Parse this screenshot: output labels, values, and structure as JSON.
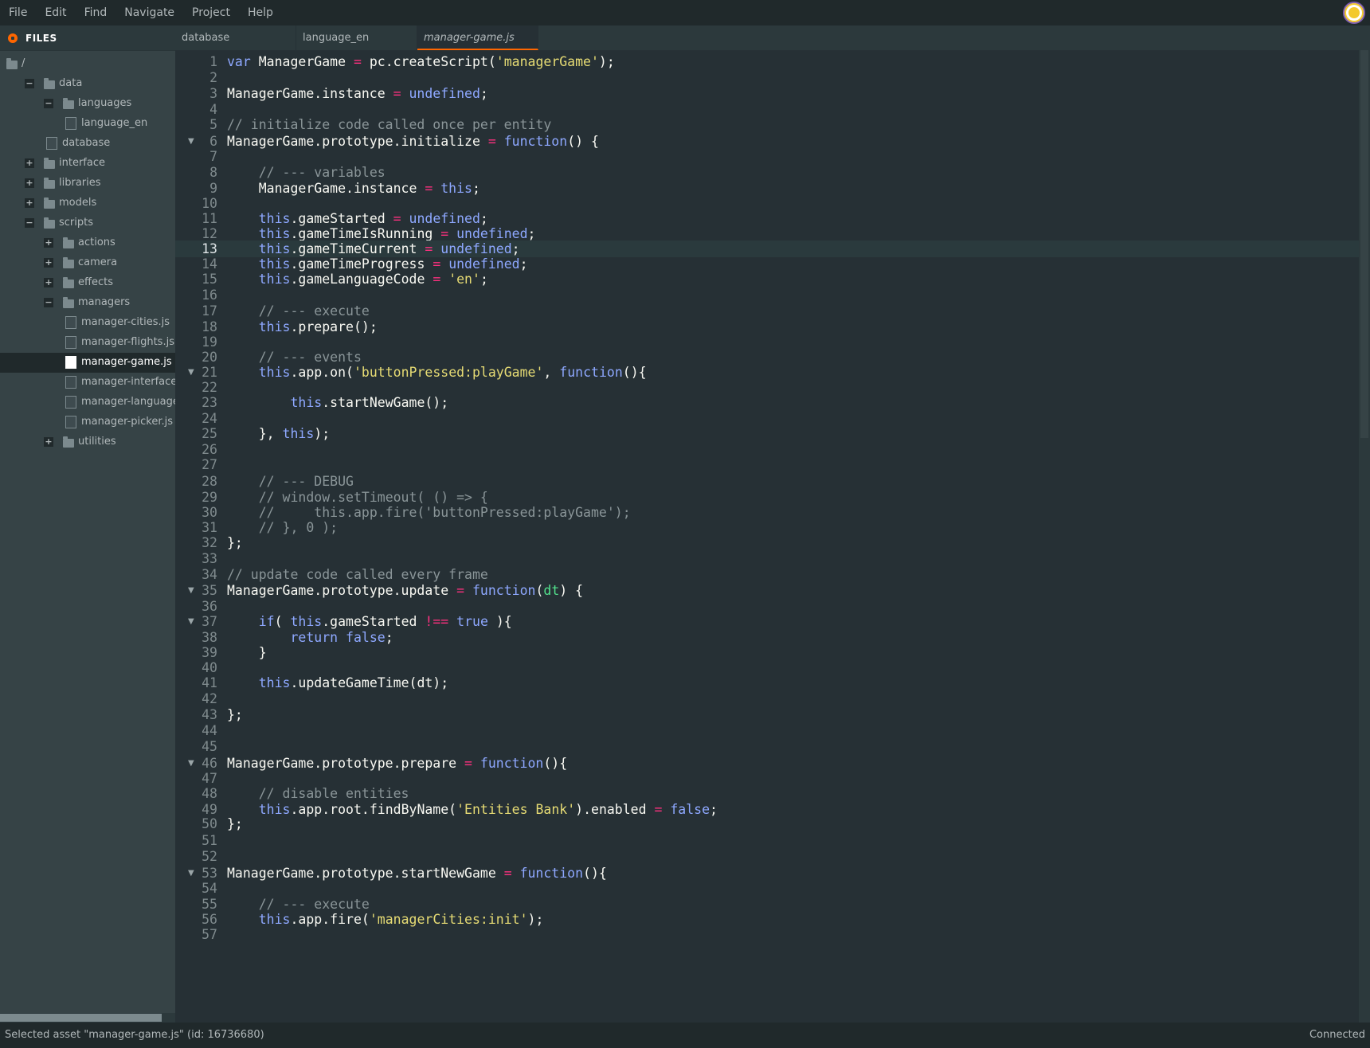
{
  "menu": [
    "File",
    "Edit",
    "Find",
    "Navigate",
    "Project",
    "Help"
  ],
  "sidebar": {
    "title": "FILES",
    "tree": [
      {
        "label": "/",
        "type": "folder",
        "indent": 0,
        "toggle": ""
      },
      {
        "label": "data",
        "type": "folder",
        "indent": 1,
        "toggle": "−"
      },
      {
        "label": "languages",
        "type": "folder",
        "indent": 2,
        "toggle": "−"
      },
      {
        "label": "language_en",
        "type": "file",
        "indent": 3,
        "toggle": ""
      },
      {
        "label": "database",
        "type": "file",
        "indent": 2,
        "toggle": ""
      },
      {
        "label": "interface",
        "type": "folder",
        "indent": 1,
        "toggle": "+"
      },
      {
        "label": "libraries",
        "type": "folder",
        "indent": 1,
        "toggle": "+"
      },
      {
        "label": "models",
        "type": "folder",
        "indent": 1,
        "toggle": "+"
      },
      {
        "label": "scripts",
        "type": "folder",
        "indent": 1,
        "toggle": "−"
      },
      {
        "label": "actions",
        "type": "folder",
        "indent": 2,
        "toggle": "+"
      },
      {
        "label": "camera",
        "type": "folder",
        "indent": 2,
        "toggle": "+"
      },
      {
        "label": "effects",
        "type": "folder",
        "indent": 2,
        "toggle": "+"
      },
      {
        "label": "managers",
        "type": "folder",
        "indent": 2,
        "toggle": "−"
      },
      {
        "label": "manager-cities.js",
        "type": "file",
        "indent": 3,
        "toggle": ""
      },
      {
        "label": "manager-flights.js",
        "type": "file",
        "indent": 3,
        "toggle": ""
      },
      {
        "label": "manager-game.js",
        "type": "file",
        "indent": 3,
        "toggle": "",
        "selected": true
      },
      {
        "label": "manager-interface.js",
        "type": "file",
        "indent": 3,
        "toggle": ""
      },
      {
        "label": "manager-language.js",
        "type": "file",
        "indent": 3,
        "toggle": ""
      },
      {
        "label": "manager-picker.js",
        "type": "file",
        "indent": 3,
        "toggle": ""
      },
      {
        "label": "utilities",
        "type": "folder",
        "indent": 2,
        "toggle": "+"
      }
    ]
  },
  "tabs": [
    {
      "label": "database",
      "active": false
    },
    {
      "label": "language_en",
      "active": false
    },
    {
      "label": "manager-game.js",
      "active": true
    }
  ],
  "editor": {
    "current_line": 13,
    "lines": [
      {
        "n": "1",
        "fold": false,
        "tokens": [
          [
            "kw",
            "var"
          ],
          [
            "p",
            " ManagerGame "
          ],
          [
            "op",
            "="
          ],
          [
            "p",
            " pc.createScript("
          ],
          [
            "str",
            "'managerGame'"
          ],
          [
            "p",
            ");"
          ]
        ]
      },
      {
        "n": "2",
        "fold": false,
        "tokens": []
      },
      {
        "n": "3",
        "fold": false,
        "tokens": [
          [
            "p",
            "ManagerGame.instance "
          ],
          [
            "op",
            "="
          ],
          [
            "p",
            " "
          ],
          [
            "kw",
            "undefined"
          ],
          [
            "p",
            ";"
          ]
        ]
      },
      {
        "n": "4",
        "fold": false,
        "tokens": []
      },
      {
        "n": "5",
        "fold": false,
        "tokens": [
          [
            "cm",
            "// initialize code called once per entity"
          ]
        ]
      },
      {
        "n": "6",
        "fold": true,
        "tokens": [
          [
            "p",
            "ManagerGame.prototype.initialize "
          ],
          [
            "op",
            "="
          ],
          [
            "p",
            " "
          ],
          [
            "kw",
            "function"
          ],
          [
            "p",
            "() {"
          ]
        ]
      },
      {
        "n": "7",
        "fold": false,
        "tokens": []
      },
      {
        "n": "8",
        "fold": false,
        "tokens": [
          [
            "p",
            "    "
          ],
          [
            "cm",
            "// --- variables"
          ]
        ]
      },
      {
        "n": "9",
        "fold": false,
        "tokens": [
          [
            "p",
            "    ManagerGame.instance "
          ],
          [
            "op",
            "="
          ],
          [
            "p",
            " "
          ],
          [
            "kw",
            "this"
          ],
          [
            "p",
            ";"
          ]
        ]
      },
      {
        "n": "10",
        "fold": false,
        "tokens": []
      },
      {
        "n": "11",
        "fold": false,
        "tokens": [
          [
            "p",
            "    "
          ],
          [
            "kw",
            "this"
          ],
          [
            "p",
            ".gameStarted "
          ],
          [
            "op",
            "="
          ],
          [
            "p",
            " "
          ],
          [
            "kw",
            "undefined"
          ],
          [
            "p",
            ";"
          ]
        ]
      },
      {
        "n": "12",
        "fold": false,
        "tokens": [
          [
            "p",
            "    "
          ],
          [
            "kw",
            "this"
          ],
          [
            "p",
            ".gameTimeIsRunning "
          ],
          [
            "op",
            "="
          ],
          [
            "p",
            " "
          ],
          [
            "kw",
            "undefined"
          ],
          [
            "p",
            ";"
          ]
        ]
      },
      {
        "n": "13",
        "fold": false,
        "tokens": [
          [
            "p",
            "    "
          ],
          [
            "kw",
            "this"
          ],
          [
            "p",
            ".gameTimeCurrent "
          ],
          [
            "op",
            "="
          ],
          [
            "p",
            " "
          ],
          [
            "kw",
            "undefined"
          ],
          [
            "p",
            ";"
          ]
        ]
      },
      {
        "n": "14",
        "fold": false,
        "tokens": [
          [
            "p",
            "    "
          ],
          [
            "kw",
            "this"
          ],
          [
            "p",
            ".gameTimeProgress "
          ],
          [
            "op",
            "="
          ],
          [
            "p",
            " "
          ],
          [
            "kw",
            "undefined"
          ],
          [
            "p",
            ";"
          ]
        ]
      },
      {
        "n": "15",
        "fold": false,
        "tokens": [
          [
            "p",
            "    "
          ],
          [
            "kw",
            "this"
          ],
          [
            "p",
            ".gameLanguageCode "
          ],
          [
            "op",
            "="
          ],
          [
            "p",
            " "
          ],
          [
            "str",
            "'en'"
          ],
          [
            "p",
            ";"
          ]
        ]
      },
      {
        "n": "16",
        "fold": false,
        "tokens": []
      },
      {
        "n": "17",
        "fold": false,
        "tokens": [
          [
            "p",
            "    "
          ],
          [
            "cm",
            "// --- execute"
          ]
        ]
      },
      {
        "n": "18",
        "fold": false,
        "tokens": [
          [
            "p",
            "    "
          ],
          [
            "kw",
            "this"
          ],
          [
            "p",
            ".prepare();"
          ]
        ]
      },
      {
        "n": "19",
        "fold": false,
        "tokens": []
      },
      {
        "n": "20",
        "fold": false,
        "tokens": [
          [
            "p",
            "    "
          ],
          [
            "cm",
            "// --- events"
          ]
        ]
      },
      {
        "n": "21",
        "fold": true,
        "tokens": [
          [
            "p",
            "    "
          ],
          [
            "kw",
            "this"
          ],
          [
            "p",
            ".app.on("
          ],
          [
            "str",
            "'buttonPressed:playGame'"
          ],
          [
            "p",
            ", "
          ],
          [
            "kw",
            "function"
          ],
          [
            "p",
            "(){"
          ]
        ]
      },
      {
        "n": "22",
        "fold": false,
        "tokens": []
      },
      {
        "n": "23",
        "fold": false,
        "tokens": [
          [
            "p",
            "        "
          ],
          [
            "kw",
            "this"
          ],
          [
            "p",
            ".startNewGame();"
          ]
        ]
      },
      {
        "n": "24",
        "fold": false,
        "tokens": []
      },
      {
        "n": "25",
        "fold": false,
        "tokens": [
          [
            "p",
            "    }, "
          ],
          [
            "kw",
            "this"
          ],
          [
            "p",
            ");"
          ]
        ]
      },
      {
        "n": "26",
        "fold": false,
        "tokens": []
      },
      {
        "n": "27",
        "fold": false,
        "tokens": []
      },
      {
        "n": "28",
        "fold": false,
        "tokens": [
          [
            "p",
            "    "
          ],
          [
            "cm",
            "// --- DEBUG"
          ]
        ]
      },
      {
        "n": "29",
        "fold": false,
        "tokens": [
          [
            "p",
            "    "
          ],
          [
            "cm",
            "// window.setTimeout( () => {"
          ]
        ]
      },
      {
        "n": "30",
        "fold": false,
        "tokens": [
          [
            "p",
            "    "
          ],
          [
            "cm",
            "//     this.app.fire('buttonPressed:playGame');"
          ]
        ]
      },
      {
        "n": "31",
        "fold": false,
        "tokens": [
          [
            "p",
            "    "
          ],
          [
            "cm",
            "// }, 0 );"
          ]
        ]
      },
      {
        "n": "32",
        "fold": false,
        "tokens": [
          [
            "p",
            "};"
          ]
        ]
      },
      {
        "n": "33",
        "fold": false,
        "tokens": []
      },
      {
        "n": "34",
        "fold": false,
        "tokens": [
          [
            "cm",
            "// update code called every frame"
          ]
        ]
      },
      {
        "n": "35",
        "fold": true,
        "tokens": [
          [
            "p",
            "ManagerGame.prototype.update "
          ],
          [
            "op",
            "="
          ],
          [
            "p",
            " "
          ],
          [
            "kw",
            "function"
          ],
          [
            "p",
            "("
          ],
          [
            "param",
            "dt"
          ],
          [
            "p",
            ") {"
          ]
        ]
      },
      {
        "n": "36",
        "fold": false,
        "tokens": []
      },
      {
        "n": "37",
        "fold": true,
        "tokens": [
          [
            "p",
            "    "
          ],
          [
            "kw",
            "if"
          ],
          [
            "p",
            "( "
          ],
          [
            "kw",
            "this"
          ],
          [
            "p",
            ".gameStarted "
          ],
          [
            "op",
            "!=="
          ],
          [
            "p",
            " "
          ],
          [
            "kw",
            "true"
          ],
          [
            "p",
            " ){"
          ]
        ]
      },
      {
        "n": "38",
        "fold": false,
        "tokens": [
          [
            "p",
            "        "
          ],
          [
            "kw",
            "return"
          ],
          [
            "p",
            " "
          ],
          [
            "kw",
            "false"
          ],
          [
            "p",
            ";"
          ]
        ]
      },
      {
        "n": "39",
        "fold": false,
        "tokens": [
          [
            "p",
            "    }"
          ]
        ]
      },
      {
        "n": "40",
        "fold": false,
        "tokens": []
      },
      {
        "n": "41",
        "fold": false,
        "tokens": [
          [
            "p",
            "    "
          ],
          [
            "kw",
            "this"
          ],
          [
            "p",
            ".updateGameTime(dt);"
          ]
        ]
      },
      {
        "n": "42",
        "fold": false,
        "tokens": []
      },
      {
        "n": "43",
        "fold": false,
        "tokens": [
          [
            "p",
            "};"
          ]
        ]
      },
      {
        "n": "44",
        "fold": false,
        "tokens": []
      },
      {
        "n": "45",
        "fold": false,
        "tokens": []
      },
      {
        "n": "46",
        "fold": true,
        "tokens": [
          [
            "p",
            "ManagerGame.prototype.prepare "
          ],
          [
            "op",
            "="
          ],
          [
            "p",
            " "
          ],
          [
            "kw",
            "function"
          ],
          [
            "p",
            "(){"
          ]
        ]
      },
      {
        "n": "47",
        "fold": false,
        "tokens": []
      },
      {
        "n": "48",
        "fold": false,
        "tokens": [
          [
            "p",
            "    "
          ],
          [
            "cm",
            "// disable entities"
          ]
        ]
      },
      {
        "n": "49",
        "fold": false,
        "tokens": [
          [
            "p",
            "    "
          ],
          [
            "kw",
            "this"
          ],
          [
            "p",
            ".app.root.findByName("
          ],
          [
            "str",
            "'Entities Bank'"
          ],
          [
            "p",
            ").enabled "
          ],
          [
            "op",
            "="
          ],
          [
            "p",
            " "
          ],
          [
            "kw",
            "false"
          ],
          [
            "p",
            ";"
          ]
        ]
      },
      {
        "n": "50",
        "fold": false,
        "tokens": [
          [
            "p",
            "};"
          ]
        ]
      },
      {
        "n": "51",
        "fold": false,
        "tokens": []
      },
      {
        "n": "52",
        "fold": false,
        "tokens": []
      },
      {
        "n": "53",
        "fold": true,
        "tokens": [
          [
            "p",
            "ManagerGame.prototype.startNewGame "
          ],
          [
            "op",
            "="
          ],
          [
            "p",
            " "
          ],
          [
            "kw",
            "function"
          ],
          [
            "p",
            "(){"
          ]
        ]
      },
      {
        "n": "54",
        "fold": false,
        "tokens": []
      },
      {
        "n": "55",
        "fold": false,
        "tokens": [
          [
            "p",
            "    "
          ],
          [
            "cm",
            "// --- execute"
          ]
        ]
      },
      {
        "n": "56",
        "fold": false,
        "tokens": [
          [
            "p",
            "    "
          ],
          [
            "kw",
            "this"
          ],
          [
            "p",
            ".app.fire("
          ],
          [
            "str",
            "'managerCities:init'"
          ],
          [
            "p",
            ");"
          ]
        ]
      },
      {
        "n": "57",
        "fold": false,
        "tokens": []
      }
    ]
  },
  "status": {
    "left": "Selected asset \"manager-game.js\" (id: 16736680)",
    "right": "Connected"
  }
}
